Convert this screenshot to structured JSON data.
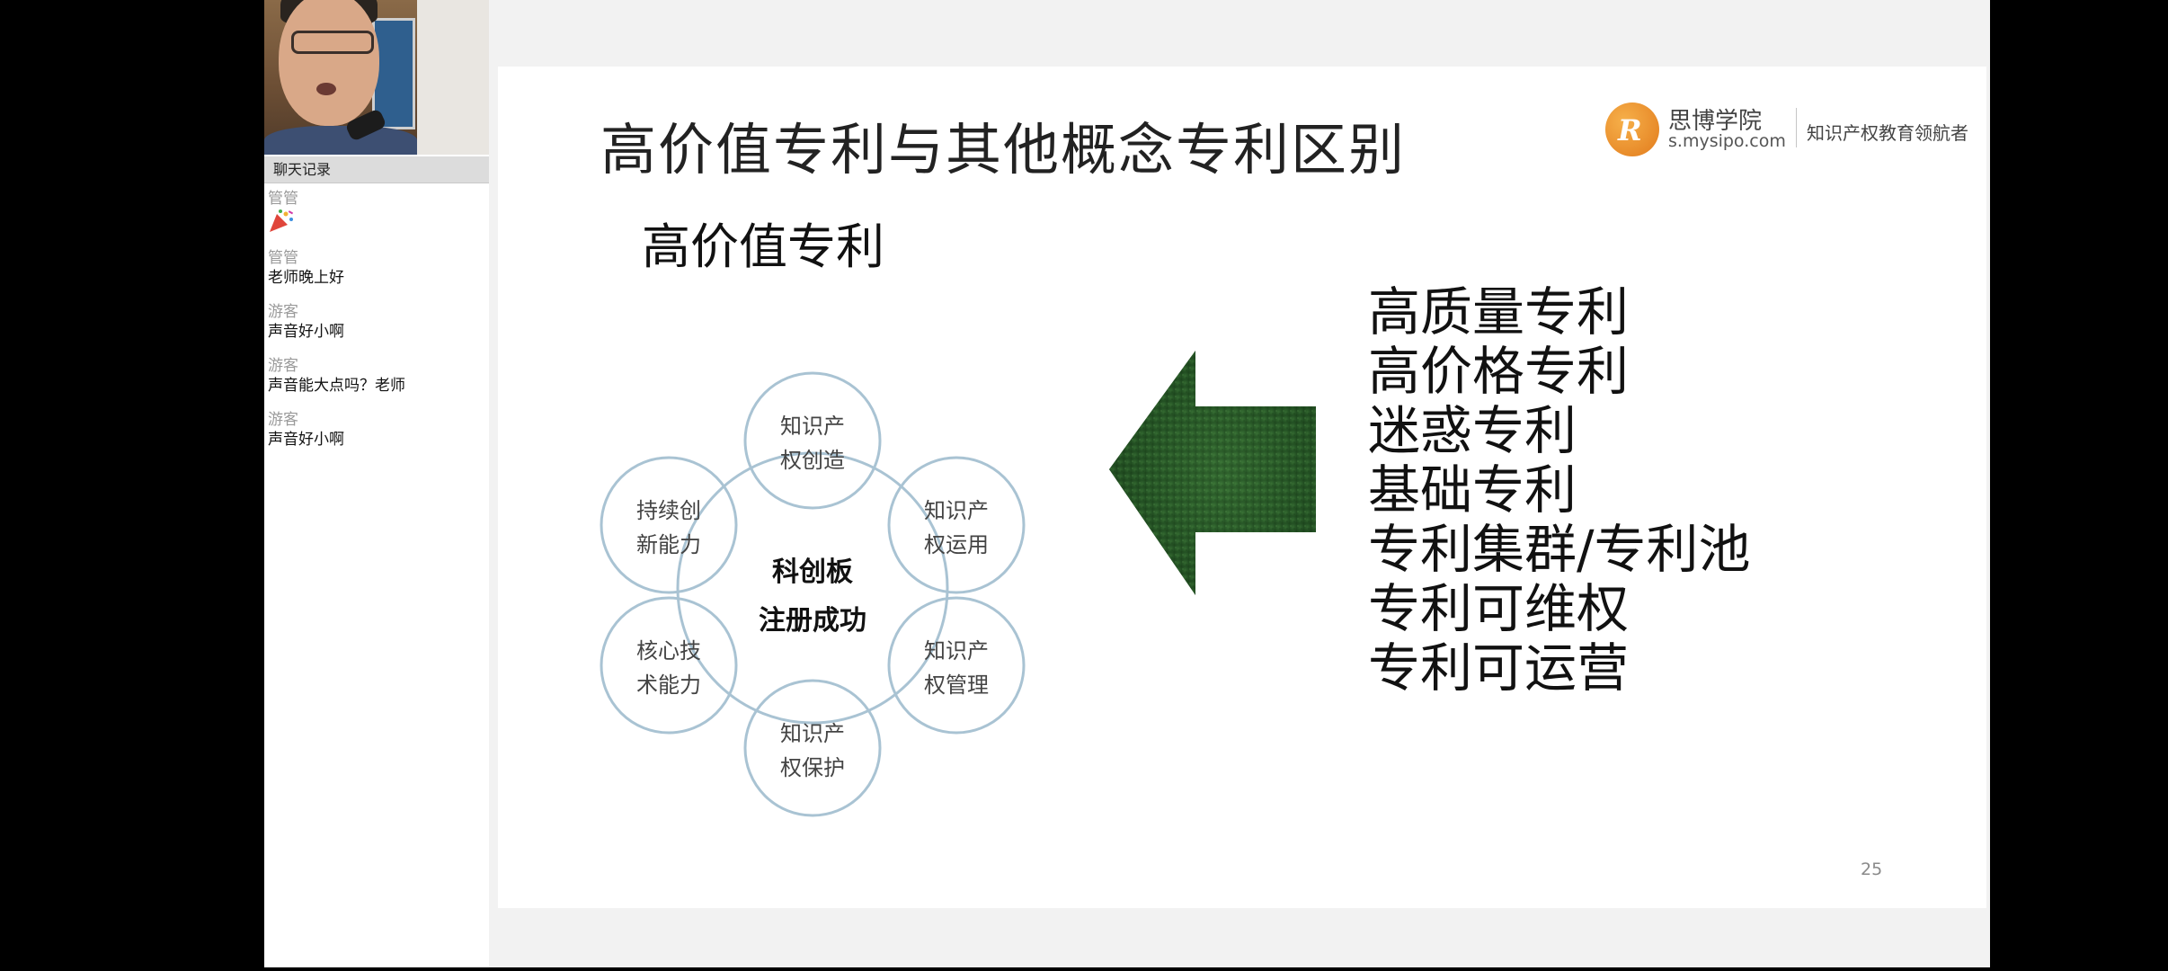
{
  "chat": {
    "header": "聊天记录",
    "messages": [
      {
        "user": "管管",
        "text": "",
        "emoji": "party-popper"
      },
      {
        "user": "管管",
        "text": "老师晚上好"
      },
      {
        "user": "游客",
        "text": "声音好小啊"
      },
      {
        "user": "游客",
        "text": "声音能大点吗？老师"
      },
      {
        "user": "游客",
        "text": "声音好小啊"
      }
    ]
  },
  "slide": {
    "title": "高价值专利与其他概念专利区别",
    "subtitle": "高价值专利",
    "logo": {
      "name_cn": "思博学院",
      "url": "s.mysipo.com",
      "slogan": "知识产权教育领航者"
    },
    "diagram": {
      "center_line1": "科创板",
      "center_line2": "注册成功",
      "nodes": [
        {
          "line1": "知识产",
          "line2": "权创造"
        },
        {
          "line1": "知识产",
          "line2": "权运用"
        },
        {
          "line1": "知识产",
          "line2": "权管理"
        },
        {
          "line1": "知识产",
          "line2": "权保护"
        },
        {
          "line1": "核心技",
          "line2": "术能力"
        },
        {
          "line1": "持续创",
          "line2": "新能力"
        }
      ]
    },
    "list": [
      "高质量专利",
      "高价格专利",
      "迷惑专利",
      "基础专利",
      "专利集群/专利池",
      "专利可维权",
      "专利可运营"
    ],
    "page_number": "25"
  },
  "colors": {
    "circle_stroke": "#a9c3d3",
    "arrow_green": "#1f4d1f",
    "logo_orange": "#e88a2a"
  }
}
